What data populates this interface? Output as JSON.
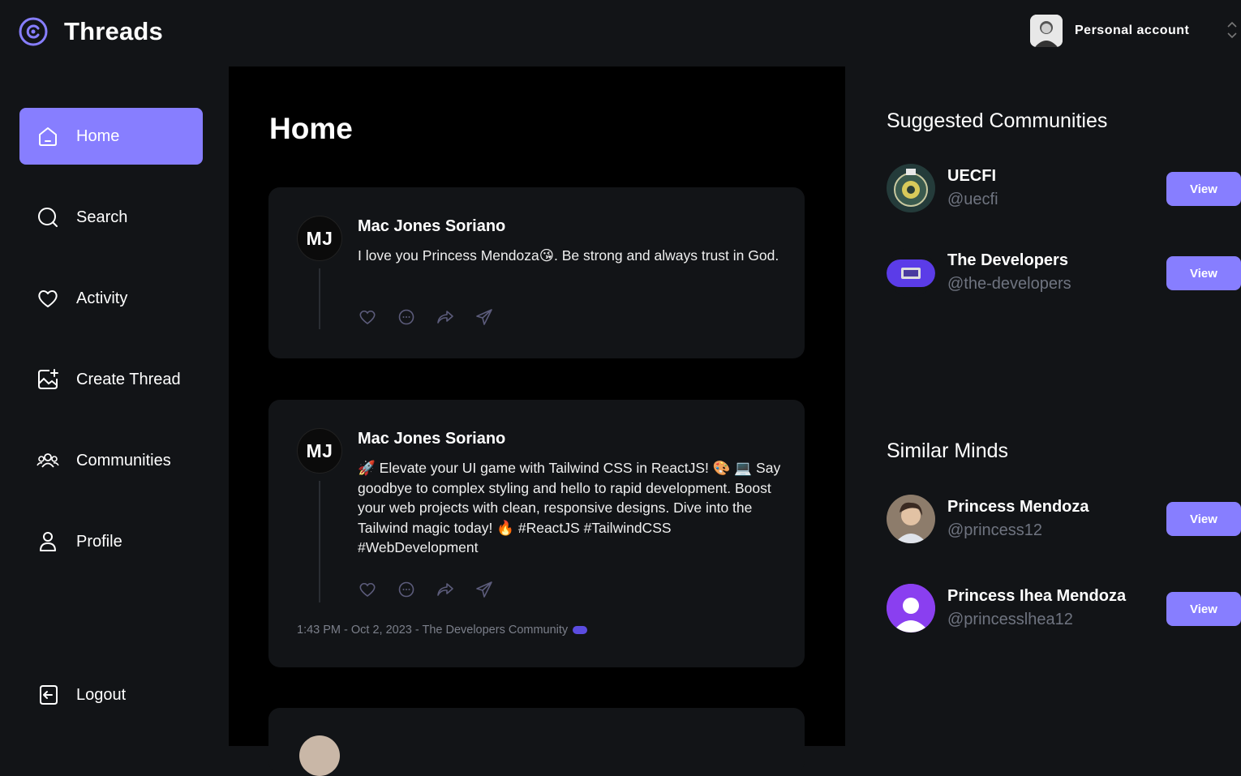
{
  "app": {
    "title": "Threads",
    "accent_color": "#877eff",
    "background": "#121417"
  },
  "account": {
    "label": "Personal account",
    "avatar_icon": "user-photo"
  },
  "sidebar": {
    "items": [
      {
        "label": "Home",
        "icon": "home-icon",
        "active": true
      },
      {
        "label": "Search",
        "icon": "search-icon",
        "active": false
      },
      {
        "label": "Activity",
        "icon": "heart-icon",
        "active": false
      },
      {
        "label": "Create Thread",
        "icon": "create-thread-icon",
        "active": false
      },
      {
        "label": "Communities",
        "icon": "communities-icon",
        "active": false
      },
      {
        "label": "Profile",
        "icon": "profile-icon",
        "active": false
      }
    ],
    "logout_label": "Logout"
  },
  "main": {
    "title": "Home",
    "threads": [
      {
        "author_initials": "MJ",
        "author": "Mac Jones Soriano",
        "text": "I love you Princess Mendoza😘. Be strong and always trust in God."
      },
      {
        "author_initials": "MJ",
        "author": "Mac Jones Soriano",
        "text": "🚀 Elevate your UI game with Tailwind CSS in ReactJS! 🎨 💻 Say goodbye to complex styling and hello to rapid development. Boost your web projects with clean, responsive designs. Dive into the Tailwind magic today! 🔥 #ReactJS #TailwindCSS #WebDevelopment",
        "meta": "1:43 PM - Oct 2, 2023 - The Developers Community"
      }
    ]
  },
  "right": {
    "suggested_title": "Suggested Communities",
    "communities": [
      {
        "name": "UECFI",
        "handle": "@uecfi",
        "button": "View"
      },
      {
        "name": "The Developers",
        "handle": "@the-developers",
        "button": "View"
      }
    ],
    "similar_title": "Similar Minds",
    "users": [
      {
        "name": "Princess Mendoza",
        "handle": "@princess12",
        "button": "View"
      },
      {
        "name": "Princess Ihea Mendoza",
        "handle": "@princesslhea12",
        "button": "View"
      }
    ]
  }
}
